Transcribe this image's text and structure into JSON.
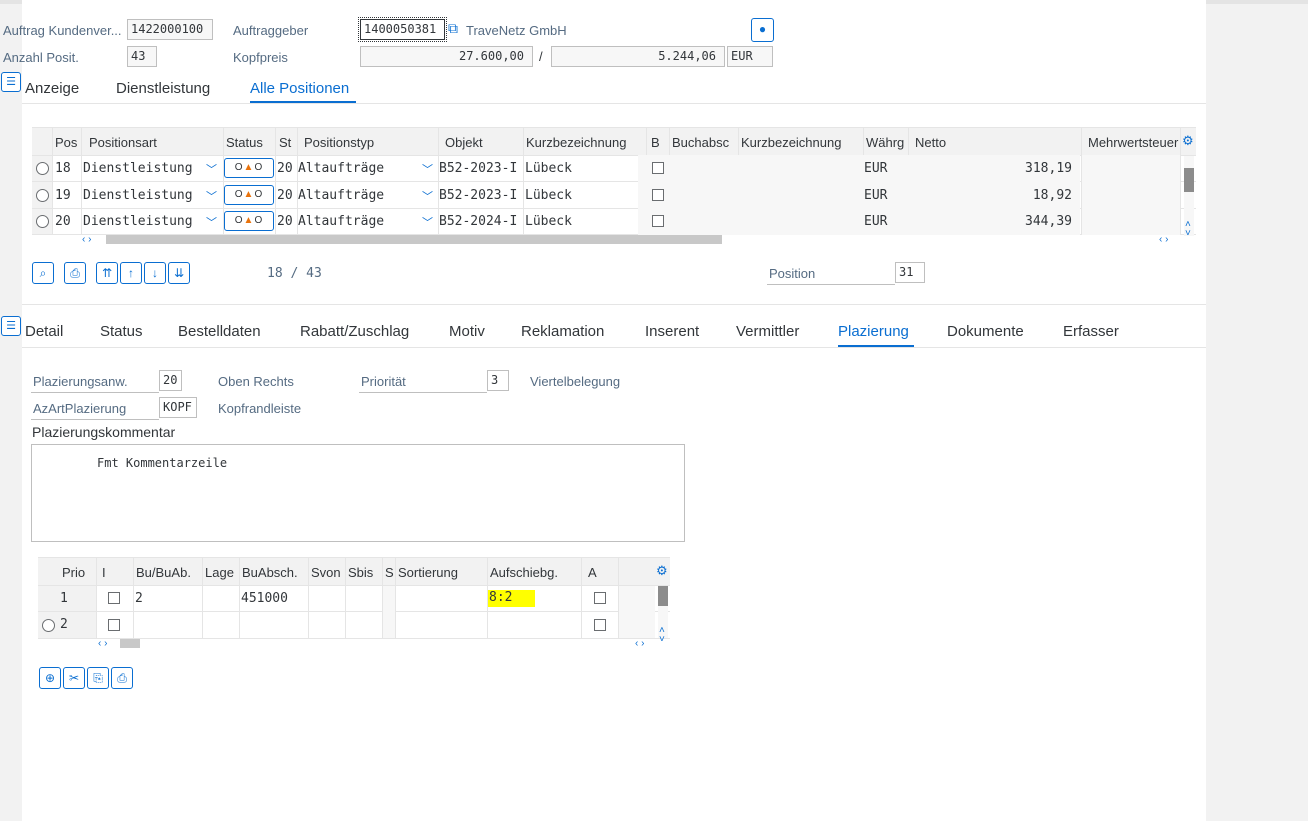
{
  "header": {
    "auftrag_label": "Auftrag Kundenver...",
    "auftrag_value": "1422000100",
    "auftraggeber_label": "Auftraggeber",
    "auftraggeber_value": "1400050381",
    "auftraggeber_name": "TraveNetz GmbH",
    "anzahl_label": "Anzahl Posit.",
    "anzahl_value": "43",
    "kopfpreis_label": "Kopfpreis",
    "kopfpreis_value": "27.600,00",
    "slash": "/",
    "tax_value": "5.244,06",
    "currency": "EUR"
  },
  "top_tabs": [
    {
      "label": "Anzeige"
    },
    {
      "label": "Dienstleistung"
    },
    {
      "label": "Alle Positionen",
      "selected": true
    }
  ],
  "positions_table": {
    "columns": [
      "Pos",
      "Positionsart",
      "Status",
      "St",
      "Positionstyp",
      "Objekt",
      "Kurzbezeichnung",
      "B",
      "Buchabsc",
      "Kurzbezeichnung",
      "Währg",
      "Netto",
      "Mehrwertsteuer"
    ],
    "rows": [
      {
        "pos": "18",
        "art": "Dienstleistung",
        "st": "20",
        "typ": "Altaufträge",
        "objekt": "B52-2023-I",
        "kurz": "Lübeck",
        "waehrung": "EUR",
        "netto": "318,19"
      },
      {
        "pos": "19",
        "art": "Dienstleistung",
        "st": "20",
        "typ": "Altaufträge",
        "objekt": "B52-2023-I",
        "kurz": "Lübeck",
        "waehrung": "EUR",
        "netto": "18,92"
      },
      {
        "pos": "20",
        "art": "Dienstleistung",
        "st": "20",
        "typ": "Altaufträge",
        "objekt": "B52-2024-I",
        "kurz": "Lübeck",
        "waehrung": "EUR",
        "netto": "344,39"
      }
    ],
    "status_glyph": "O▲O"
  },
  "pager": {
    "range": "18 / 43",
    "position_label": "Position",
    "position_value": "31"
  },
  "detail_tabs": [
    {
      "label": "Detail"
    },
    {
      "label": "Status"
    },
    {
      "label": "Bestelldaten"
    },
    {
      "label": "Rabatt/Zuschlag"
    },
    {
      "label": "Motiv"
    },
    {
      "label": "Reklamation"
    },
    {
      "label": "Inserent"
    },
    {
      "label": "Vermittler"
    },
    {
      "label": "Plazierung",
      "selected": true
    },
    {
      "label": "Dokumente"
    },
    {
      "label": "Erfasser"
    }
  ],
  "placement": {
    "anw_label": "Plazierungsanw.",
    "anw_value": "20",
    "anw_text": "Oben Rechts",
    "prio_label": "Priorität",
    "prio_value": "3",
    "prio_text": "Viertelbelegung",
    "azart_label": "AzArtPlazierung",
    "azart_value": "KOPF",
    "azart_text": "Kopfrandleiste",
    "kommentar_label": "Plazierungskommentar",
    "kommentar_header": "Fmt Kommentarzeile"
  },
  "prio_table": {
    "columns": [
      "Prio",
      "I",
      "Bu/BuAb.",
      "Lage",
      "BuAbsch.",
      "Svon",
      "Sbis",
      "S",
      "Sortierung",
      "Aufschiebg.",
      "A"
    ],
    "rows": [
      {
        "prio": "1",
        "bu": "2",
        "buabsch": "451000",
        "aufschieb": "8:2"
      },
      {
        "prio": "2",
        "bu": "",
        "buabsch": "",
        "aufschieb": ""
      }
    ]
  },
  "colors": {
    "accent": "#0a6ed1",
    "highlight": "#ffff00",
    "status_triangle": "#e9730c"
  }
}
